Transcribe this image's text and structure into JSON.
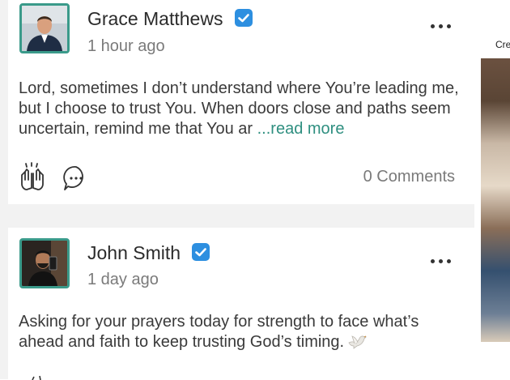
{
  "posts": [
    {
      "author": "Grace Matthews",
      "time": "1 hour ago",
      "text": "Lord, sometimes I don’t understand where You’re leading me, but I choose to trust You. When doors close and paths seem uncertain, remind me that You ar ",
      "read_more": "...read more",
      "comments": "0 Comments"
    },
    {
      "author": "John Smith",
      "time": "1 day ago",
      "text": "Asking for your prayers today for strength to face what’s ahead and faith to keep trusting God’s timing."
    }
  ],
  "side": {
    "label": "Cre"
  },
  "colors": {
    "accent": "#2f8f80",
    "verified": "#2d8fe0",
    "avatar_border": "#3a9a8a"
  },
  "icons": [
    "verified-badge-icon",
    "more-options-icon",
    "praying-hands-icon",
    "comment-icon",
    "dove-icon"
  ]
}
